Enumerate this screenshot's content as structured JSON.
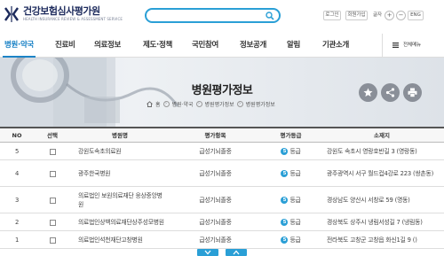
{
  "header": {
    "logo_title": "건강보험심사평가원",
    "logo_subtitle": "HEALTH INSURANCE REVIEW & ASSESSMENT SERVICE",
    "search_placeholder": "",
    "login": "로그인",
    "signup": "회원가입",
    "font_label": "글자",
    "font_plus": "+",
    "font_minus": "−",
    "lang": "ENG"
  },
  "nav": {
    "items": [
      "병원·약국",
      "진료비",
      "의료정보",
      "제도·정책",
      "국민참여",
      "정보공개",
      "알림",
      "기관소개"
    ],
    "all_menu": "전체메뉴"
  },
  "banner": {
    "title": "병원평가정보",
    "breadcrumb": [
      "홈",
      "병원·약국",
      "병원평가정보",
      "병원평가정보"
    ]
  },
  "table": {
    "headers": [
      "NO",
      "선택",
      "병원명",
      "평가항목",
      "평가등급",
      "소재지"
    ],
    "rows": [
      {
        "no": "5",
        "name": "강원도속초의료원",
        "item": "급성기뇌졸중",
        "grade_num": "5",
        "grade": "등급",
        "addr": "강원도 속초시 영랑호반길 3 (영랑동)"
      },
      {
        "no": "4",
        "name": "광주한국병원",
        "item": "급성기뇌졸중",
        "grade_num": "5",
        "grade": "등급",
        "addr": "광주광역시 서구 월드컵4강로 223 (쌍촌동)"
      },
      {
        "no": "3",
        "name": "의료법인 보원의료재단 웅상중앙병원",
        "item": "급성기뇌졸중",
        "grade_num": "5",
        "grade": "등급",
        "addr": "경상남도 양산시 서창로 59 (명동)"
      },
      {
        "no": "2",
        "name": "의료법인상백의료재단상주성모병원",
        "item": "급성기뇌졸중",
        "grade_num": "5",
        "grade": "등급",
        "addr": "경상북도 상주시 냉림서성길 7 (냉림동)"
      },
      {
        "no": "1",
        "name": "의료법인석천재단고창병원",
        "item": "급성기뇌졸중",
        "grade_num": "5",
        "grade": "등급",
        "addr": "전라북도 고창군 고창읍 화신1길 9 ()"
      }
    ]
  },
  "colors": {
    "accent": "#2a9fd6",
    "nav_active": "#1c83c6",
    "brand_navy": "#1c2a5c",
    "action_button": "#8a8f98"
  },
  "icons": {
    "logo": "hira-logo-icon",
    "search": "search-icon",
    "menu": "hamburger-icon",
    "home": "home-icon",
    "favorite": "star-icon",
    "share": "share-icon",
    "print": "printer-icon"
  }
}
